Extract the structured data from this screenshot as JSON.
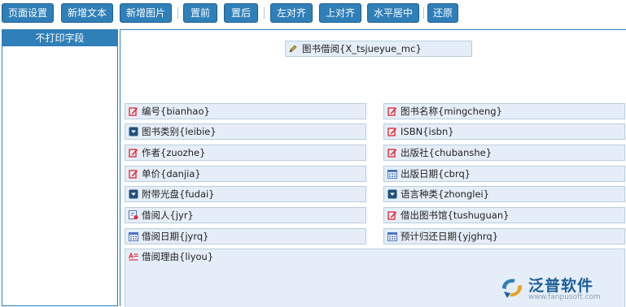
{
  "toolbar": {
    "buttons": [
      {
        "label": "页面设置"
      },
      {
        "label": "新增文本"
      },
      {
        "label": "新增图片"
      },
      {
        "label": "置前"
      },
      {
        "label": "置后"
      },
      {
        "label": "左对齐"
      },
      {
        "label": "上对齐"
      },
      {
        "label": "水平居中"
      },
      {
        "label": "还原"
      }
    ]
  },
  "left_panel": {
    "header": "不打印字段"
  },
  "design": {
    "title_field": {
      "label": "图书借阅{X_tsjueyue_mc}",
      "icon": "pen-icon"
    },
    "fields": [
      {
        "label": "编号{bianhao}",
        "icon": "edit-icon"
      },
      {
        "label": "图书名称{mingcheng}",
        "icon": "edit-icon"
      },
      {
        "label": "图书类别{leibie}",
        "icon": "dropdown-icon"
      },
      {
        "label": "ISBN{isbn}",
        "icon": "edit-icon"
      },
      {
        "label": "作者{zuozhe}",
        "icon": "edit-icon"
      },
      {
        "label": "出版社{chubanshe}",
        "icon": "edit-icon"
      },
      {
        "label": "单价{danjia}",
        "icon": "edit-icon"
      },
      {
        "label": "出版日期{cbrq}",
        "icon": "calendar-icon"
      },
      {
        "label": "附带光盘{fudai}",
        "icon": "dropdown-icon"
      },
      {
        "label": "语言种类{zhonglei}",
        "icon": "dropdown-icon"
      },
      {
        "label": "借阅人{jyr}",
        "icon": "user-picker-icon"
      },
      {
        "label": "借出图书馆{tushuguan}",
        "icon": "edit-icon"
      },
      {
        "label": "借阅日期{jyrq}",
        "icon": "calendar-icon"
      },
      {
        "label": "预计归还日期{yjghrq}",
        "icon": "calendar-icon"
      },
      {
        "label": "借阅理由{liyou}",
        "icon": "textarea-icon"
      }
    ]
  },
  "logo": {
    "brand": "泛普软件",
    "url": "www.fanpusoft.com"
  },
  "colors": {
    "accent": "#2f7fb9",
    "field_bg": "#e5eef8",
    "edit_red": "#e0303a",
    "calendar_blue": "#4a72c4"
  }
}
